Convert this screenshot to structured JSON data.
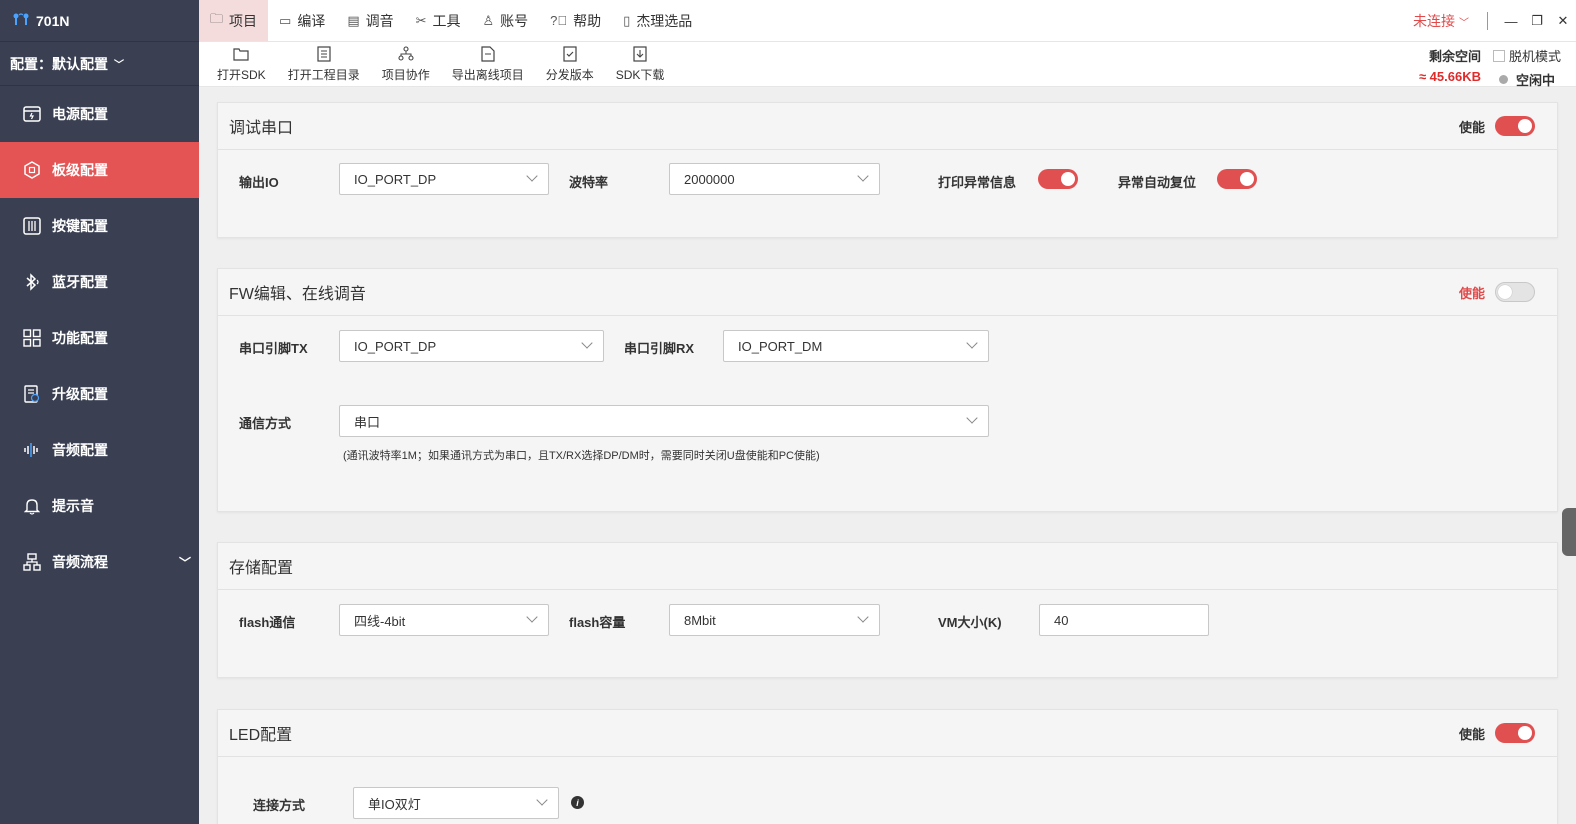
{
  "app": {
    "title": "701N"
  },
  "sidebar": {
    "config_label": "配置：默认配置",
    "items": [
      {
        "label": "电源配置",
        "icon": "power-config-icon"
      },
      {
        "label": "板级配置",
        "icon": "board-config-icon",
        "active": true
      },
      {
        "label": "按键配置",
        "icon": "key-config-icon"
      },
      {
        "label": "蓝牙配置",
        "icon": "bluetooth-icon"
      },
      {
        "label": "功能配置",
        "icon": "function-grid-icon"
      },
      {
        "label": "升级配置",
        "icon": "upgrade-icon"
      },
      {
        "label": "音频配置",
        "icon": "audio-wave-icon"
      },
      {
        "label": "提示音",
        "icon": "bell-icon"
      },
      {
        "label": "音频流程",
        "icon": "flow-icon",
        "expandable": true
      }
    ]
  },
  "topmenu": [
    {
      "label": "项目",
      "icon": "folder-icon",
      "active": true
    },
    {
      "label": "编译",
      "icon": "compile-icon"
    },
    {
      "label": "调音",
      "icon": "tuning-icon"
    },
    {
      "label": "工具",
      "icon": "tools-icon"
    },
    {
      "label": "账号",
      "icon": "user-icon"
    },
    {
      "label": "帮助",
      "icon": "help-icon"
    },
    {
      "label": "杰理选品",
      "icon": "select-icon"
    }
  ],
  "connection": {
    "status": "未连接"
  },
  "toolbar": [
    {
      "label": "打开SDK"
    },
    {
      "label": "打开工程目录"
    },
    {
      "label": "项目协作"
    },
    {
      "label": "导出离线项目"
    },
    {
      "label": "分发版本"
    },
    {
      "label": "SDK下载"
    }
  ],
  "storage": {
    "label": "剩余空间",
    "value": "≈ 45.66KB"
  },
  "offline": {
    "label": "脱机模式",
    "state": "空闲中"
  },
  "sections": {
    "debug_uart": {
      "title": "调试串口",
      "enable_label": "使能",
      "enabled": true,
      "output_io_label": "输出IO",
      "output_io_value": "IO_PORT_DP",
      "baud_label": "波特率",
      "baud_value": "2000000",
      "print_exc_label": "打印异常信息",
      "auto_reset_label": "异常自动复位"
    },
    "fw_edit": {
      "title": "FW编辑、在线调音",
      "enable_label": "使能",
      "enabled": false,
      "tx_label": "串口引脚TX",
      "tx_value": "IO_PORT_DP",
      "rx_label": "串口引脚RX",
      "rx_value": "IO_PORT_DM",
      "comm_label": "通信方式",
      "comm_value": "串口",
      "note": "(通讯波特率1M；如果通讯方式为串口，且TX/RX选择DP/DM时，需要同时关闭U盘使能和PC使能)"
    },
    "storage_cfg": {
      "title": "存储配置",
      "flash_comm_label": "flash通信",
      "flash_comm_value": "四线-4bit",
      "flash_size_label": "flash容量",
      "flash_size_value": "8Mbit",
      "vm_label": "VM大小(K)",
      "vm_value": "40"
    },
    "led_cfg": {
      "title": "LED配置",
      "enable_label": "使能",
      "enabled": true,
      "conn_label": "连接方式",
      "conn_value": "单IO双灯"
    }
  }
}
